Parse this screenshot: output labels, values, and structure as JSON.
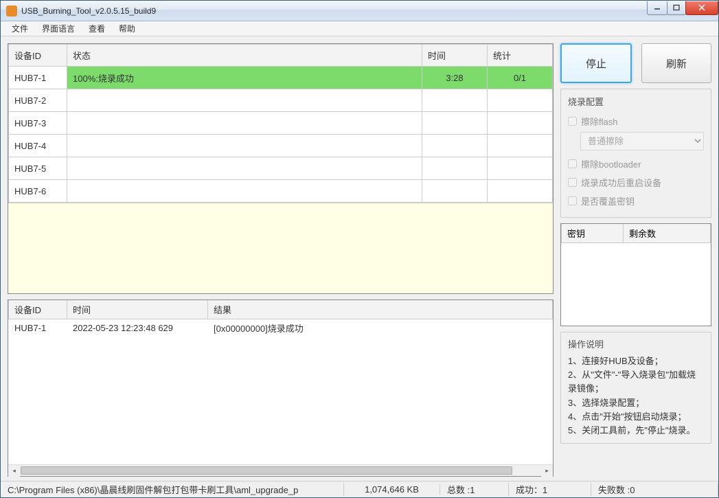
{
  "window": {
    "title": "USB_Burning_Tool_v2.0.5.15_build9"
  },
  "menu": {
    "file": "文件",
    "language": "界面语言",
    "view": "查看",
    "help": "帮助"
  },
  "top_table": {
    "headers": {
      "device_id": "设备ID",
      "status": "状态",
      "time": "时间",
      "stat": "统计"
    },
    "rows": [
      {
        "device_id": "HUB7-1",
        "status": "100%:烧录成功",
        "time": "3:28",
        "stat": "0/1",
        "success": true
      },
      {
        "device_id": "HUB7-2",
        "status": "",
        "time": "",
        "stat": ""
      },
      {
        "device_id": "HUB7-3",
        "status": "",
        "time": "",
        "stat": ""
      },
      {
        "device_id": "HUB7-4",
        "status": "",
        "time": "",
        "stat": ""
      },
      {
        "device_id": "HUB7-5",
        "status": "",
        "time": "",
        "stat": ""
      },
      {
        "device_id": "HUB7-6",
        "status": "",
        "time": "",
        "stat": ""
      }
    ]
  },
  "bottom_table": {
    "headers": {
      "device_id": "设备ID",
      "time": "时间",
      "result": "结果"
    },
    "rows": [
      {
        "device_id": "HUB7-1",
        "time": "2022-05-23 12:23:48 629",
        "result": "[0x00000000]烧录成功"
      }
    ]
  },
  "buttons": {
    "stop": "停止",
    "refresh": "刷新"
  },
  "config": {
    "legend": "烧录配置",
    "erase_flash": "擦除flash",
    "erase_mode": "普通擦除",
    "erase_bootloader": "擦除bootloader",
    "reboot_after": "烧录成功后重启设备",
    "overwrite_key": "是否覆盖密钥"
  },
  "keys": {
    "headers": {
      "key": "密钥",
      "remaining": "剩余数"
    }
  },
  "instructions": {
    "legend": "操作说明",
    "l1": "1、连接好HUB及设备；",
    "l2": "2、从\"文件\"-\"导入烧录包\"加载烧录镜像；",
    "l3": "3、选择烧录配置；",
    "l4": "4、点击\"开始\"按钮启动烧录；",
    "l5": "5、关闭工具前，先\"停止\"烧录。"
  },
  "statusbar": {
    "path": "C:\\Program Files (x86)\\晶晨线刷固件解包打包带卡刷工具\\aml_upgrade_p",
    "size": "1,074,646 KB",
    "total_label": "总数 :",
    "total_val": "1",
    "success_label": "成功：",
    "success_val": "1",
    "fail_label": "失败数 :",
    "fail_val": "0"
  }
}
